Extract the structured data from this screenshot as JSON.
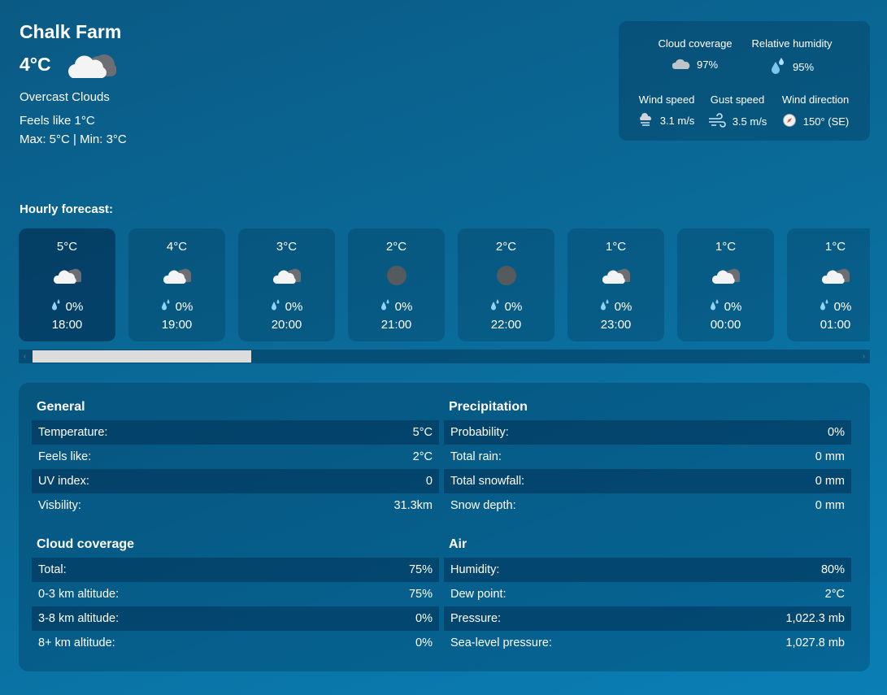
{
  "location": {
    "name": "Chalk Farm",
    "temp": "4°C",
    "condition": "Overcast Clouds",
    "feels_like": "Feels like 1°C",
    "max_min": "Max: 5°C | Min: 3°C",
    "icon": "overcast-cloud-icon"
  },
  "stats": {
    "cloud_coverage": {
      "label": "Cloud coverage",
      "value": "97%",
      "icon": "cloud-icon"
    },
    "humidity": {
      "label": "Relative humidity",
      "value": "95%",
      "icon": "humidity-drops-icon"
    },
    "wind_speed": {
      "label": "Wind speed",
      "value": "3.1 m/s",
      "icon": "wind-speed-icon"
    },
    "gust_speed": {
      "label": "Gust speed",
      "value": "3.5 m/s",
      "icon": "gust-icon"
    },
    "wind_direction": {
      "label": "Wind direction",
      "value": "150° (SE)",
      "icon": "compass-icon"
    }
  },
  "hourly": {
    "title": "Hourly forecast:",
    "items": [
      {
        "temp": "5°C",
        "precip": "0%",
        "time": "18:00",
        "icon": "cloud"
      },
      {
        "temp": "4°C",
        "precip": "0%",
        "time": "19:00",
        "icon": "cloud"
      },
      {
        "temp": "3°C",
        "precip": "0%",
        "time": "20:00",
        "icon": "cloud"
      },
      {
        "temp": "2°C",
        "precip": "0%",
        "time": "21:00",
        "icon": "moon"
      },
      {
        "temp": "2°C",
        "precip": "0%",
        "time": "22:00",
        "icon": "moon"
      },
      {
        "temp": "1°C",
        "precip": "0%",
        "time": "23:00",
        "icon": "cloud"
      },
      {
        "temp": "1°C",
        "precip": "0%",
        "time": "00:00",
        "icon": "cloud"
      },
      {
        "temp": "1°C",
        "precip": "0%",
        "time": "01:00",
        "icon": "cloud"
      }
    ]
  },
  "details": {
    "general": {
      "title": "General",
      "rows": [
        {
          "label": "Temperature:",
          "value": "5°C"
        },
        {
          "label": "Feels like:",
          "value": "2°C"
        },
        {
          "label": "UV index:",
          "value": "0"
        },
        {
          "label": "Visbility:",
          "value": "31.3km"
        }
      ]
    },
    "precipitation": {
      "title": "Precipitation",
      "rows": [
        {
          "label": "Probability:",
          "value": "0%"
        },
        {
          "label": "Total rain:",
          "value": "0 mm"
        },
        {
          "label": "Total snowfall:",
          "value": "0 mm"
        },
        {
          "label": "Snow depth:",
          "value": "0 mm"
        }
      ]
    },
    "cloud": {
      "title": "Cloud coverage",
      "rows": [
        {
          "label": "Total:",
          "value": "75%"
        },
        {
          "label": "0-3 km altitude:",
          "value": "75%"
        },
        {
          "label": "3-8 km altitude:",
          "value": "0%"
        },
        {
          "label": "8+ km altitude:",
          "value": "0%"
        }
      ]
    },
    "air": {
      "title": "Air",
      "rows": [
        {
          "label": "Humidity:",
          "value": "80%"
        },
        {
          "label": "Dew point:",
          "value": "2°C"
        },
        {
          "label": "Pressure:",
          "value": "1,022.3 mb"
        },
        {
          "label": "Sea-level pressure:",
          "value": "1,027.8 mb"
        }
      ]
    }
  },
  "colors": {
    "background_top": "#0a5a84",
    "background_bottom": "#0a7fb5",
    "drop": "#8fd3f5",
    "moon": "#555a5e"
  }
}
